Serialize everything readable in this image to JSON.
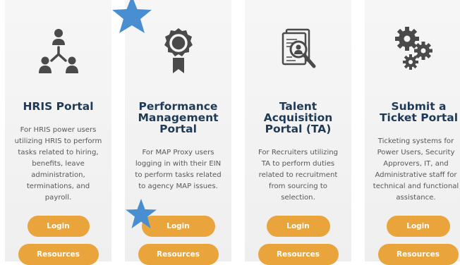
{
  "cards": [
    {
      "icon": "org-chart-icon",
      "title": "HRIS Portal",
      "description": "For HRIS power users utilizing HRIS to perform tasks related to hiring, benefits, leave administration, terminations, and payroll.",
      "login_label": "Login",
      "resources_label": "Resources"
    },
    {
      "icon": "award-ribbon-icon",
      "title": "Performance Management Portal",
      "description": "For MAP Proxy users logging in with their EIN to perform tasks related to agency MAP issues.",
      "login_label": "Login",
      "resources_label": "Resources"
    },
    {
      "icon": "resume-search-icon",
      "title": "Talent Acquisition Portal (TA)",
      "description": "For Recruiters utilizing TA to perform duties related to recruitment from sourcing to selection.",
      "login_label": "Login",
      "resources_label": "Resources"
    },
    {
      "icon": "gears-icon",
      "title": "Submit a Ticket Portal",
      "description": "Ticketing systems for Power Users, Security Approvers, IT, and Administrative staff for technical and functional assistance.",
      "login_label": "Login",
      "resources_label": "Resources"
    }
  ],
  "colors": {
    "button": "#e9a43c",
    "title": "#1f3a57",
    "icon": "#4a4a4a",
    "star": "#4a8ed2"
  }
}
